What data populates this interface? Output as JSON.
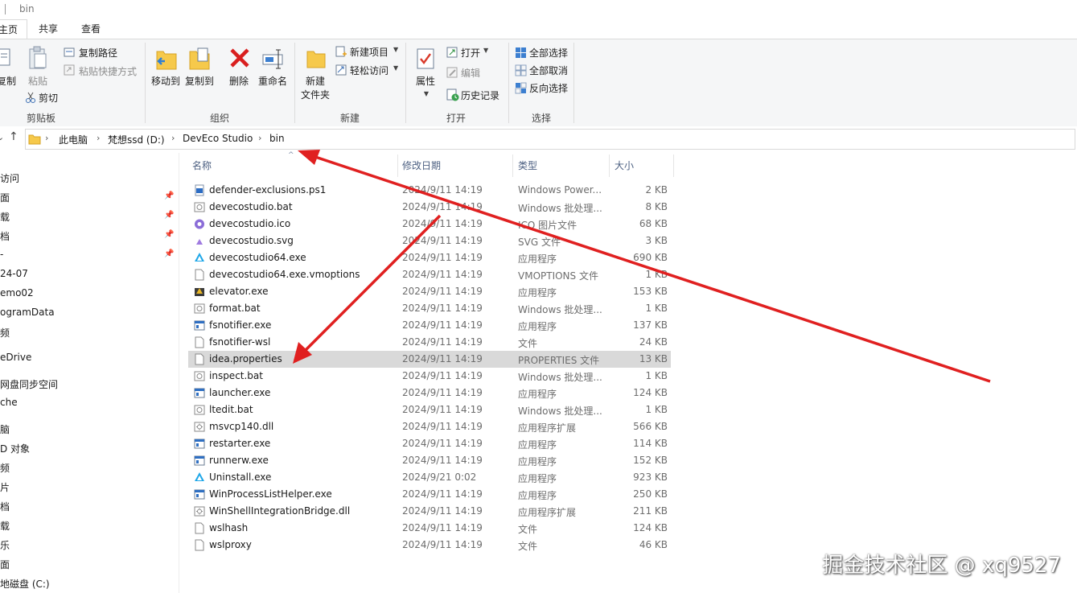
{
  "window": {
    "title": "bin"
  },
  "tabs": [
    {
      "label": "主页",
      "active": true
    },
    {
      "label": "共享",
      "active": false
    },
    {
      "label": "查看",
      "active": false
    }
  ],
  "ribbon": {
    "clipboard": {
      "copy": "复制",
      "paste": "粘贴",
      "copy_path": "复制路径",
      "paste_shortcut": "粘贴快捷方式",
      "cut": "剪切",
      "label": "剪贴板"
    },
    "organize": {
      "move_to": "移动到",
      "copy_to": "复制到",
      "delete": "删除",
      "rename": "重命名",
      "label": "组织"
    },
    "new": {
      "new_folder_line1": "新建",
      "new_folder_line2": "文件夹",
      "new_item": "新建项目",
      "easy_access": "轻松访问",
      "label": "新建"
    },
    "open": {
      "properties": "属性",
      "open": "打开",
      "edit": "编辑",
      "history": "历史记录",
      "label": "打开"
    },
    "select": {
      "select_all": "全部选择",
      "select_none": "全部取消",
      "invert": "反向选择",
      "label": "选择"
    }
  },
  "address": {
    "crumbs": [
      "此电脑",
      "梵想ssd (D:)",
      "DevEco Studio",
      "bin"
    ]
  },
  "nav_pane": {
    "items": [
      "访问",
      "面",
      "载",
      "档",
      "-",
      "24-07",
      "emo02",
      "ogramData",
      "频",
      "eDrive",
      "网盘同步空间",
      "che",
      "脑",
      "D 对象",
      "频",
      "片",
      "档",
      "载",
      "乐",
      "面",
      "地磁盘 (C:)"
    ]
  },
  "columns": {
    "name": "名称",
    "date": "修改日期",
    "type": "类型",
    "size": "大小"
  },
  "files": [
    {
      "name": "defender-exclusions.ps1",
      "date": "2024/9/11 14:19",
      "type": "Windows Power...",
      "size": "2 KB",
      "icon": "ps1-icon"
    },
    {
      "name": "devecostudio.bat",
      "date": "2024/9/11 14:19",
      "type": "Windows 批处理...",
      "size": "8 KB",
      "icon": "bat-icon"
    },
    {
      "name": "devecostudio.ico",
      "date": "2024/9/11 14:19",
      "type": "ICO 图片文件",
      "size": "68 KB",
      "icon": "ico-icon"
    },
    {
      "name": "devecostudio.svg",
      "date": "2024/9/11 14:19",
      "type": "SVG 文件",
      "size": "3 KB",
      "icon": "svg-icon"
    },
    {
      "name": "devecostudio64.exe",
      "date": "2024/9/11 14:19",
      "type": "应用程序",
      "size": "690 KB",
      "icon": "deveco-app-icon"
    },
    {
      "name": "devecostudio64.exe.vmoptions",
      "date": "2024/9/11 14:19",
      "type": "VMOPTIONS 文件",
      "size": "1 KB",
      "icon": "document-icon"
    },
    {
      "name": "elevator.exe",
      "date": "2024/9/11 14:19",
      "type": "应用程序",
      "size": "153 KB",
      "icon": "elevator-icon"
    },
    {
      "name": "format.bat",
      "date": "2024/9/11 14:19",
      "type": "Windows 批处理...",
      "size": "1 KB",
      "icon": "bat-icon"
    },
    {
      "name": "fsnotifier.exe",
      "date": "2024/9/11 14:19",
      "type": "应用程序",
      "size": "137 KB",
      "icon": "exe-icon"
    },
    {
      "name": "fsnotifier-wsl",
      "date": "2024/9/11 14:19",
      "type": "文件",
      "size": "24 KB",
      "icon": "document-icon"
    },
    {
      "name": "idea.properties",
      "date": "2024/9/11 14:19",
      "type": "PROPERTIES 文件",
      "size": "13 KB",
      "icon": "document-icon",
      "selected": true
    },
    {
      "name": "inspect.bat",
      "date": "2024/9/11 14:19",
      "type": "Windows 批处理...",
      "size": "1 KB",
      "icon": "bat-icon"
    },
    {
      "name": "launcher.exe",
      "date": "2024/9/11 14:19",
      "type": "应用程序",
      "size": "124 KB",
      "icon": "exe-icon"
    },
    {
      "name": "ltedit.bat",
      "date": "2024/9/11 14:19",
      "type": "Windows 批处理...",
      "size": "1 KB",
      "icon": "bat-icon"
    },
    {
      "name": "msvcp140.dll",
      "date": "2024/9/11 14:19",
      "type": "应用程序扩展",
      "size": "566 KB",
      "icon": "dll-icon"
    },
    {
      "name": "restarter.exe",
      "date": "2024/9/11 14:19",
      "type": "应用程序",
      "size": "114 KB",
      "icon": "exe-icon"
    },
    {
      "name": "runnerw.exe",
      "date": "2024/9/11 14:19",
      "type": "应用程序",
      "size": "152 KB",
      "icon": "exe-icon"
    },
    {
      "name": "Uninstall.exe",
      "date": "2024/9/21 0:02",
      "type": "应用程序",
      "size": "923 KB",
      "icon": "deveco-app-icon"
    },
    {
      "name": "WinProcessListHelper.exe",
      "date": "2024/9/11 14:19",
      "type": "应用程序",
      "size": "250 KB",
      "icon": "exe-icon"
    },
    {
      "name": "WinShellIntegrationBridge.dll",
      "date": "2024/9/11 14:19",
      "type": "应用程序扩展",
      "size": "211 KB",
      "icon": "dll-icon"
    },
    {
      "name": "wslhash",
      "date": "2024/9/11 14:19",
      "type": "文件",
      "size": "124 KB",
      "icon": "document-icon"
    },
    {
      "name": "wslproxy",
      "date": "2024/9/11 14:19",
      "type": "文件",
      "size": "46 KB",
      "icon": "document-icon"
    }
  ],
  "watermark": "掘金技术社区 @ xq9527",
  "colors": {
    "accent": "#1979ca",
    "annotation": "#e02020",
    "selection": "#d9d9d9"
  }
}
